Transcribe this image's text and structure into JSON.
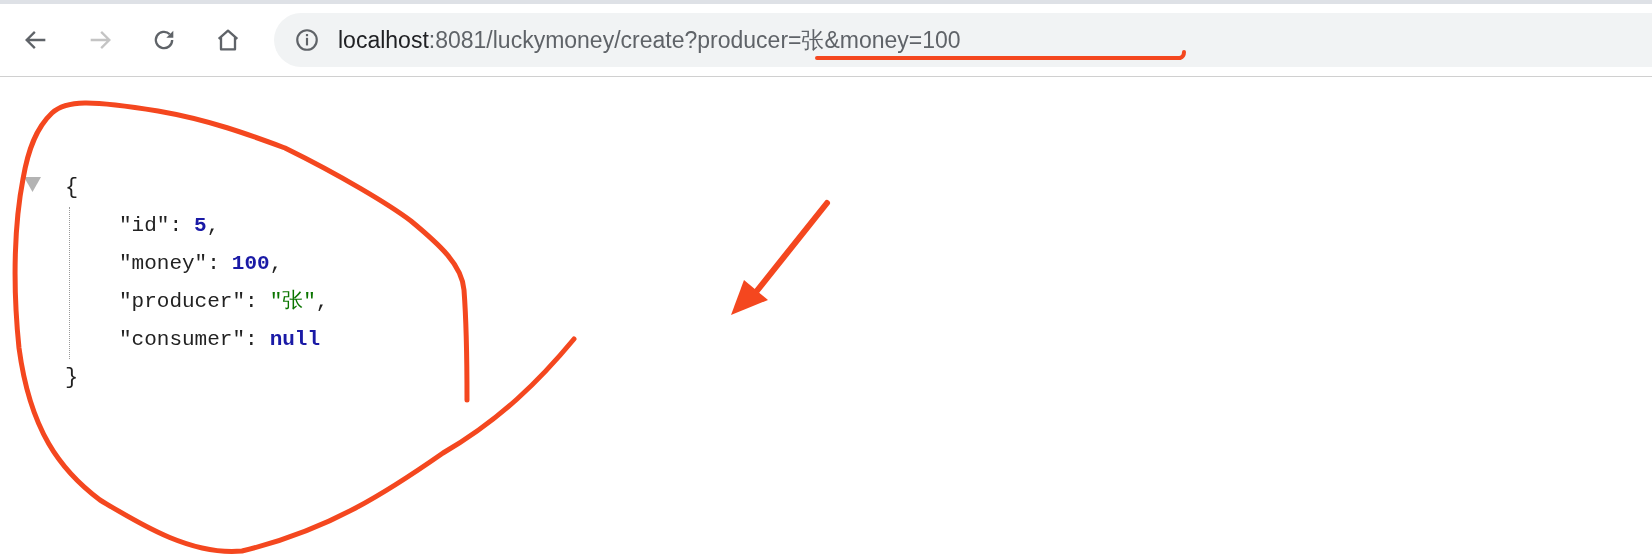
{
  "toolbar": {
    "forward_disabled": true
  },
  "address_bar": {
    "host": "localhost",
    "path": ":8081/luckymoney/create?producer=张&money=100"
  },
  "json_viewer": {
    "expanded": true,
    "open": "{",
    "close": "}",
    "entries": [
      {
        "key": "\"id\":",
        "value": "5",
        "kind": "number",
        "comma": ","
      },
      {
        "key": "\"money\":",
        "value": "100",
        "kind": "number",
        "comma": ","
      },
      {
        "key": "\"producer\":",
        "value": "\"张\"",
        "kind": "string",
        "comma": ","
      },
      {
        "key": "\"consumer\":",
        "value": "null",
        "kind": "null"
      }
    ]
  }
}
